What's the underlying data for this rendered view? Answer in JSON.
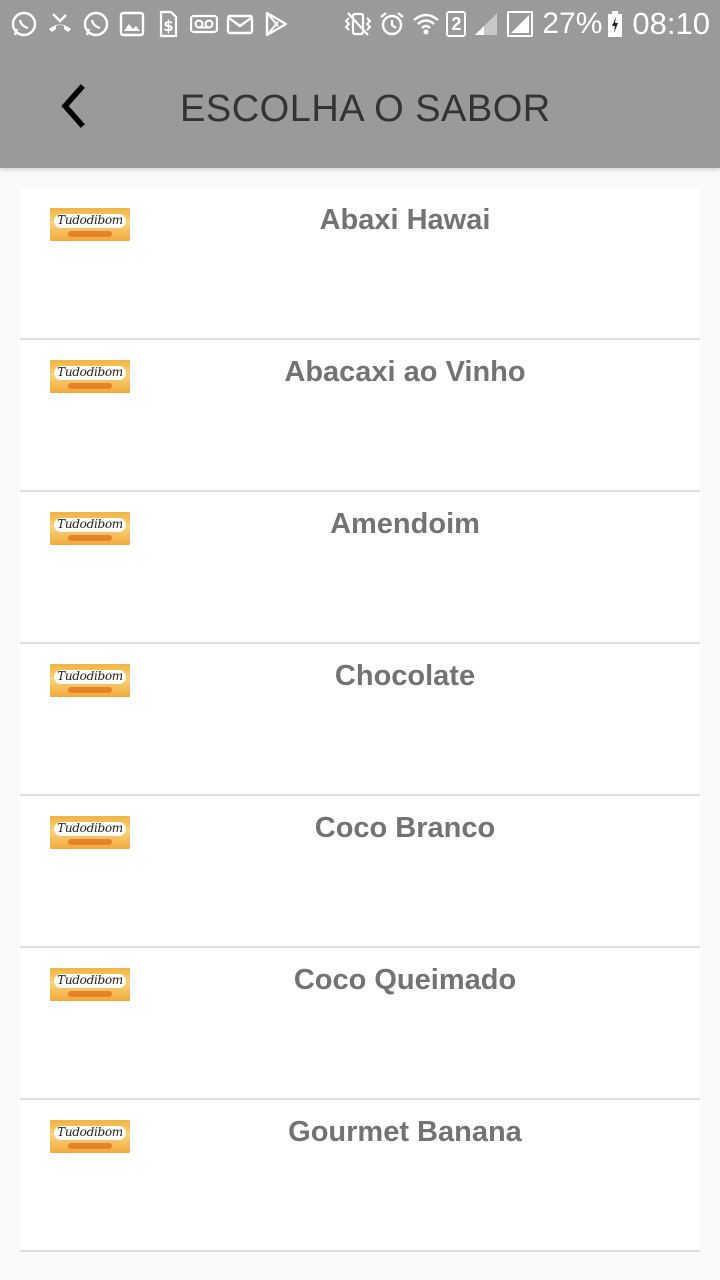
{
  "status_bar": {
    "left_icons": [
      "whatsapp-icon",
      "missed-call-icon",
      "whatsapp-icon",
      "gallery-icon",
      "dollar-sim-icon",
      "voicemail-icon",
      "mail-icon",
      "play-store-icon"
    ],
    "right_icons": [
      "vibrate-icon",
      "alarm-icon",
      "wifi-icon",
      "signal-icon",
      "signal-icon"
    ],
    "sim_badge": "2",
    "battery": "27%",
    "time": "08:10"
  },
  "toolbar": {
    "title": "ESCOLHA O SABOR",
    "back_icon": "chevron-left-icon"
  },
  "brand": {
    "logo_text": "Tudodibom"
  },
  "colors": {
    "toolbar_bg": "#9a9a9a",
    "item_text": "#737373",
    "divider": "#dedede",
    "page_bg": "#fafafa"
  },
  "items": [
    {
      "label": "Abaxi Hawai"
    },
    {
      "label": "Abacaxi ao Vinho"
    },
    {
      "label": "Amendoim"
    },
    {
      "label": "Chocolate"
    },
    {
      "label": "Coco Branco"
    },
    {
      "label": "Coco Queimado"
    },
    {
      "label": "Gourmet Banana"
    }
  ]
}
